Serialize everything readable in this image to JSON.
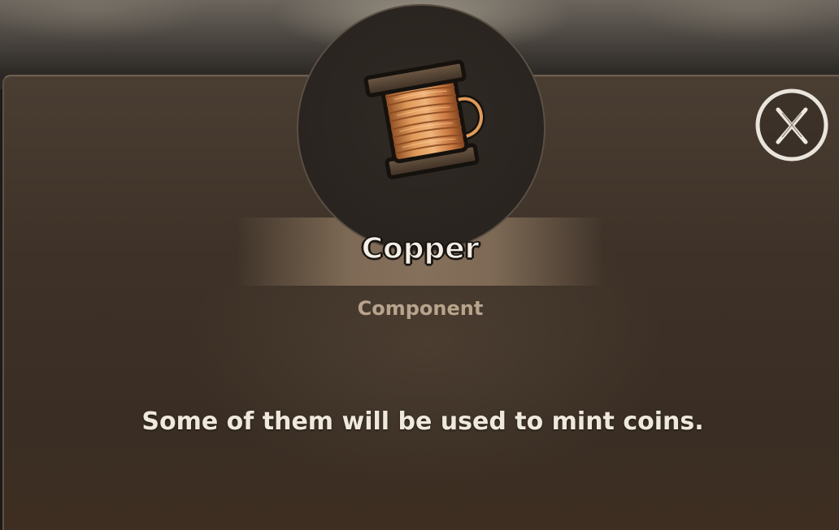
{
  "item": {
    "name": "Copper",
    "category": "Component",
    "description": "Some of them will be used to mint coins.",
    "icon": "copper-wire-spool-icon"
  },
  "controls": {
    "close_icon": "close-icon"
  },
  "colors": {
    "panel": "#3e3228",
    "title_band": "#8c7660",
    "category_text": "#b8a48c",
    "description_text": "#efe8dc",
    "copper": "#d88a4a"
  }
}
